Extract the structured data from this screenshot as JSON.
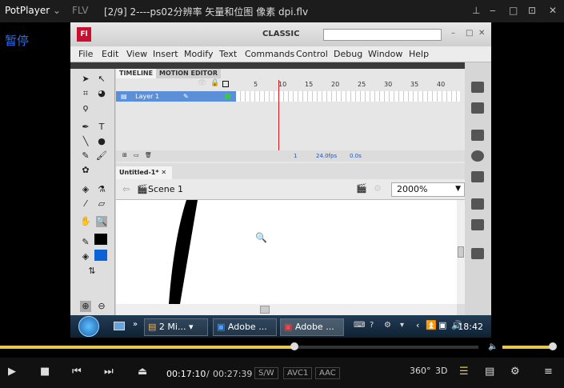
{
  "player": {
    "app_name": "PotPlayer",
    "format": "FLV",
    "title": "[2/9] 2----ps02分辨率 矢量和位图 像素 dpi.flv",
    "pause_label": "暂停"
  },
  "flash": {
    "workspace": "CLASSIC",
    "menu": [
      "File",
      "Edit",
      "View",
      "Insert",
      "Modify",
      "Text",
      "Commands",
      "Control",
      "Debug",
      "Window",
      "Help"
    ],
    "timeline_tab": "TIMELINE",
    "motion_tab": "MOTION EDITOR",
    "layer_name": "Layer 1",
    "frame_numbers": [
      "5",
      "10",
      "15",
      "20",
      "25",
      "30",
      "35",
      "40"
    ],
    "footer": {
      "frame": "1",
      "fps": "24.0fps",
      "time": "0.0s"
    },
    "doc_tab": "Untitled-1*",
    "scene": "Scene 1",
    "zoom": "2000%"
  },
  "taskbar": {
    "tasks": [
      "2 Mi...",
      "Adobe ...",
      "Adobe ..."
    ],
    "clock": "18:42"
  },
  "playback": {
    "progress": 0.615,
    "volume": 0.95,
    "current_time": "00:17:10",
    "separator": "/",
    "total_time": "00:27:39",
    "badges": [
      "S/W",
      "AVC1",
      "AAC"
    ],
    "toggles": [
      "360°",
      "3D"
    ]
  }
}
